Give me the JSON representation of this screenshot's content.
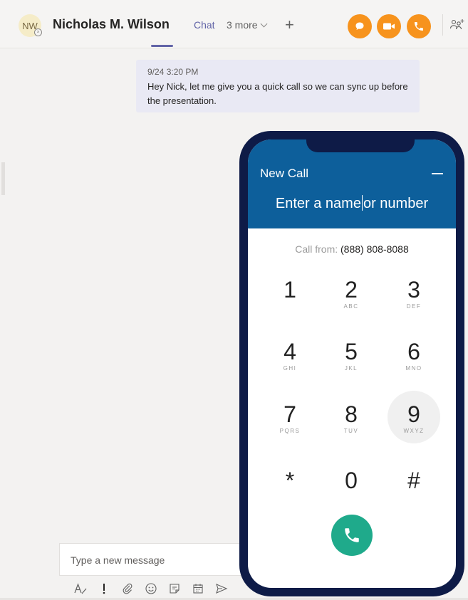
{
  "header": {
    "avatar_initials": "NW",
    "contact_name": "Nicholas M. Wilson",
    "tabs": [
      {
        "label": "Chat"
      },
      {
        "label": "3 more"
      }
    ],
    "accent_color": "#f7931d"
  },
  "message": {
    "time": "9/24 3:20 PM",
    "text": "Hey Nick, let me give you a quick call so we can sync up before the presentation."
  },
  "composer": {
    "placeholder": "Type a new message"
  },
  "dialer": {
    "title": "New Call",
    "input_before_caret": "Enter a name",
    "input_after_caret": "or number",
    "call_from_label": "Call from:",
    "call_from_number": "(888) 808-8088",
    "keys": [
      {
        "digit": "1",
        "letters": ""
      },
      {
        "digit": "2",
        "letters": "ABC"
      },
      {
        "digit": "3",
        "letters": "DEF"
      },
      {
        "digit": "4",
        "letters": "GHI"
      },
      {
        "digit": "5",
        "letters": "JKL"
      },
      {
        "digit": "6",
        "letters": "MNO"
      },
      {
        "digit": "7",
        "letters": "PQRS"
      },
      {
        "digit": "8",
        "letters": "TUV"
      },
      {
        "digit": "9",
        "letters": "WXYZ"
      },
      {
        "digit": "*",
        "letters": ""
      },
      {
        "digit": "0",
        "letters": ""
      },
      {
        "digit": "#",
        "letters": ""
      }
    ],
    "pressed_key": "9",
    "header_color": "#0d5f9b",
    "call_button_color": "#1faa8b"
  }
}
